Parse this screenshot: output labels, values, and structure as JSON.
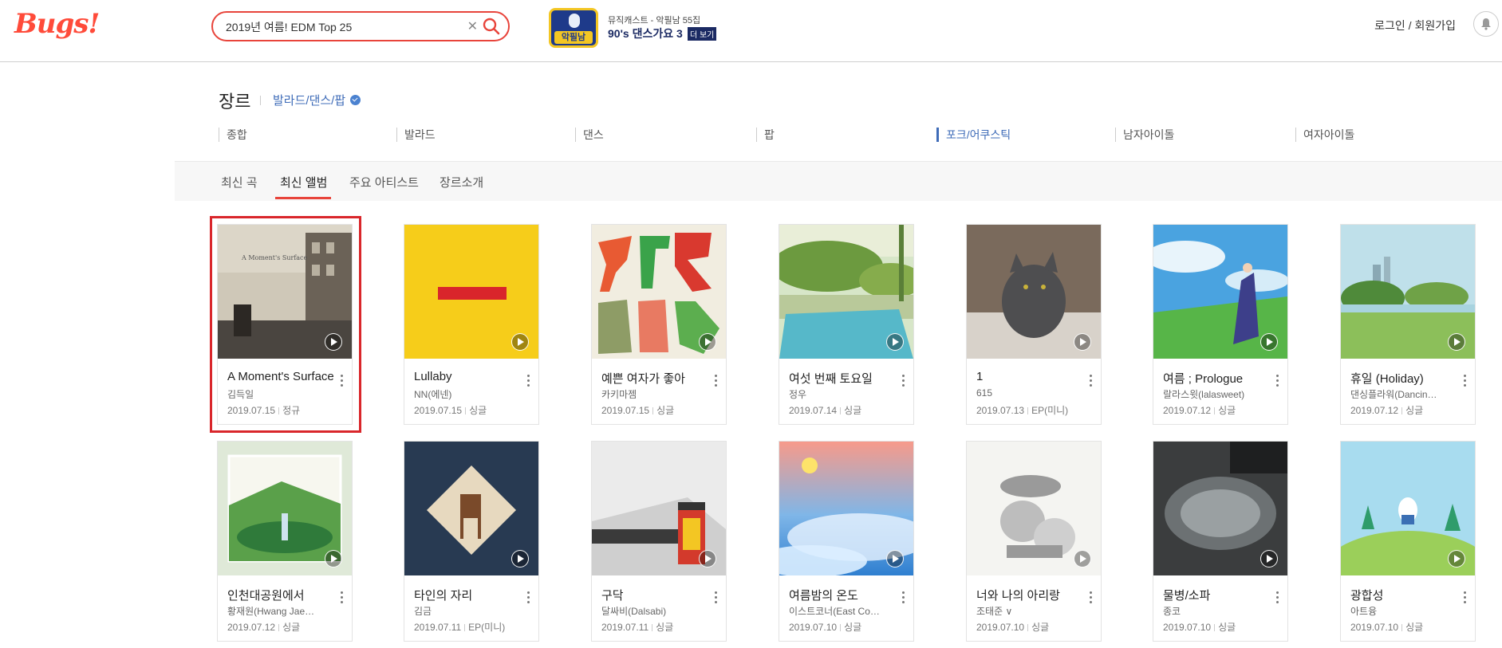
{
  "header": {
    "logo": "Bugs!",
    "search": {
      "value": "2019년 여름! EDM Top 25",
      "placeholder": ""
    },
    "promo": {
      "badge": "악필남",
      "subtitle": "뮤직캐스트 - 악필남 55집",
      "title": "90's 댄스가요 3",
      "more": "더 보기"
    },
    "login": "로그인 / 회원가입"
  },
  "genre": {
    "title": "장르",
    "selected": "발라드/댄스/팝",
    "categories": [
      "종합",
      "발라드",
      "댄스",
      "팝",
      "포크/어쿠스틱",
      "남자아이돌",
      "여자아이돌"
    ],
    "active_category": "포크/어쿠스틱"
  },
  "tabs": [
    "최신 곡",
    "최신 앨범",
    "주요 아티스트",
    "장르소개"
  ],
  "active_tab": "최신 앨범",
  "albums": [
    {
      "title": "A Moment's Surface",
      "artist": "김득일",
      "date": "2019.07.15",
      "type": "정규"
    },
    {
      "title": "Lullaby",
      "artist": "NN(에넨)",
      "date": "2019.07.15",
      "type": "싱글"
    },
    {
      "title": "예쁜 여자가 좋아",
      "artist": "카키마젬",
      "date": "2019.07.15",
      "type": "싱글"
    },
    {
      "title": "여섯 번째 토요일",
      "artist": "정우",
      "date": "2019.07.14",
      "type": "싱글"
    },
    {
      "title": "1",
      "artist": "615",
      "date": "2019.07.13",
      "type": "EP(미니)"
    },
    {
      "title": "여름 ; Prologue",
      "artist": "랄라스윗(lalasweet)",
      "date": "2019.07.12",
      "type": "싱글"
    },
    {
      "title": "휴일 (Holiday)",
      "artist": "댄싱플라워(Dancin…",
      "date": "2019.07.12",
      "type": "싱글"
    },
    {
      "title": "인천대공원에서",
      "artist": "황재원(Hwang Jae…",
      "date": "2019.07.12",
      "type": "싱글"
    },
    {
      "title": "타인의 자리",
      "artist": "김금",
      "date": "2019.07.11",
      "type": "EP(미니)"
    },
    {
      "title": "구닥",
      "artist": "달싸비(Dalsabi)",
      "date": "2019.07.11",
      "type": "싱글"
    },
    {
      "title": "여름밤의 온도",
      "artist": "이스트코너(East Co…",
      "date": "2019.07.10",
      "type": "싱글"
    },
    {
      "title": "너와 나의 아리랑",
      "artist": "조태준 ∨",
      "date": "2019.07.10",
      "type": "싱글"
    },
    {
      "title": "물병/소파",
      "artist": "종코",
      "date": "2019.07.10",
      "type": "싱글"
    },
    {
      "title": "광합성",
      "artist": "아트융",
      "date": "2019.07.10",
      "type": "싱글"
    }
  ],
  "colors": {
    "accent": "#e8443b",
    "link": "#3f6cb8",
    "highlight": "#d9262b"
  }
}
